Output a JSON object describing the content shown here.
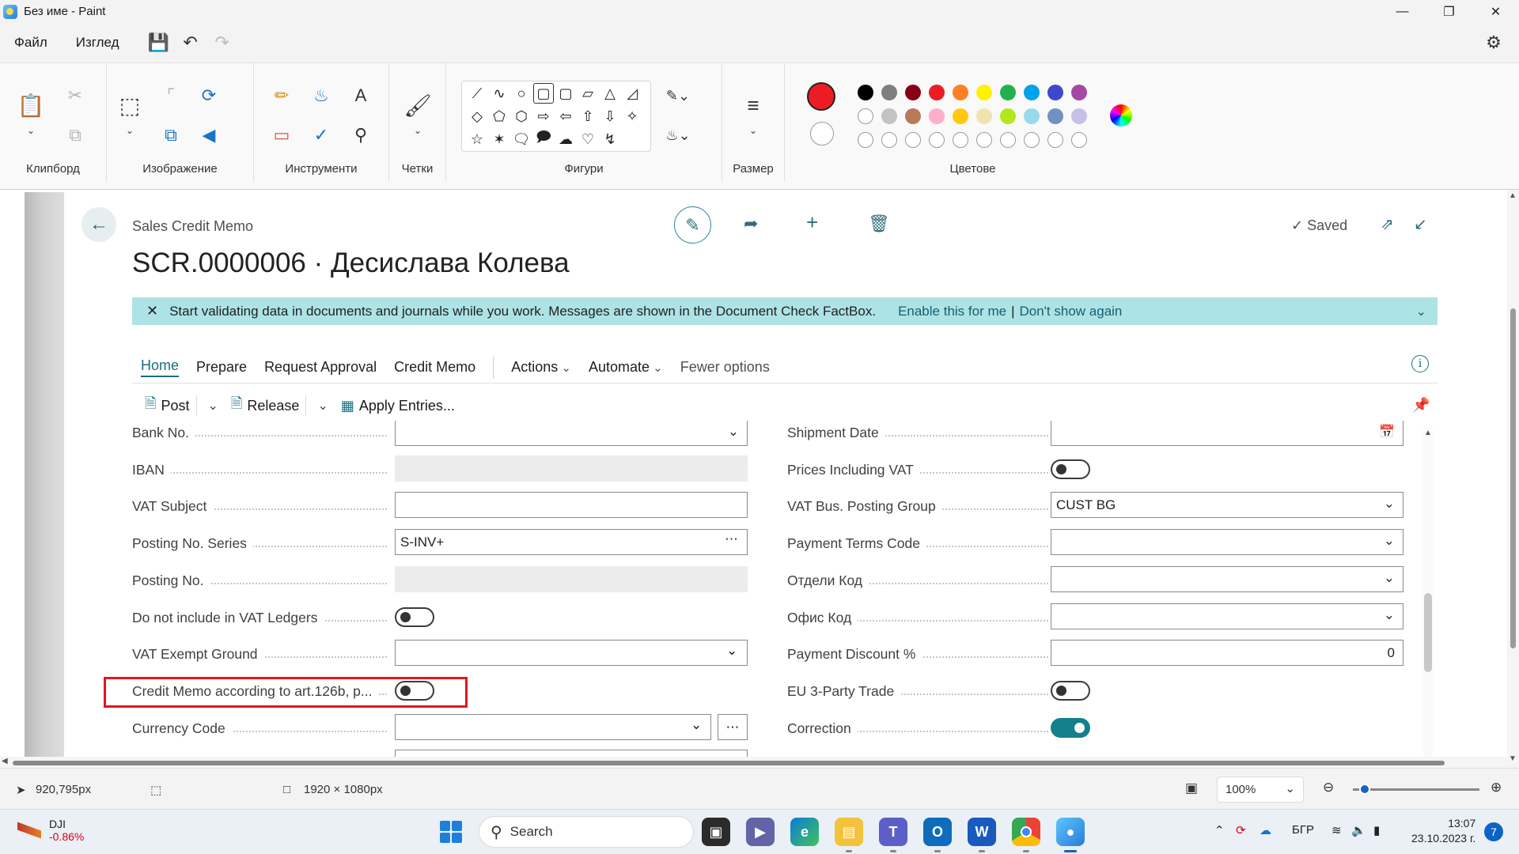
{
  "window": {
    "title": "Без име - Paint",
    "app_icon": "paint-icon",
    "controls": [
      "minimize-icon",
      "maximize-icon",
      "close-icon"
    ]
  },
  "menu": {
    "file": "Файл",
    "view": "Изглед",
    "icons": [
      "save-icon",
      "undo-icon",
      "redo-icon",
      "settings-icon"
    ]
  },
  "ribbon": {
    "groups": {
      "clipboard": "Клипборд",
      "image": "Изображение",
      "tools": "Инструменти",
      "brushes": "Четки",
      "shapes": "Фигури",
      "size": "Размер",
      "colors": "Цветове"
    },
    "palette_row1": [
      "#000000",
      "#7f7f7f",
      "#880015",
      "#ed1c24",
      "#ff7f27",
      "#fff200",
      "#22b14c",
      "#00a2e8",
      "#3f48cc",
      "#a349a4"
    ],
    "palette_row2": [
      "#ffffff",
      "#c3c3c3",
      "#b97a57",
      "#ffaec9",
      "#ffc90e",
      "#efe4b0",
      "#b5e61d",
      "#99d9ea",
      "#7092be",
      "#c8bfe7"
    ],
    "primary_color": "#ed1c24",
    "secondary_color": "#ffffff"
  },
  "bc": {
    "caption": "Sales Credit Memo",
    "title": "SCR.0000006 · Десислава Колева",
    "saved": "Saved",
    "banner": {
      "message": "Start validating data in documents and journals while you work. Messages are shown in the Document Check FactBox.",
      "enable": "Enable this for me",
      "separator": "|",
      "dismiss": "Don't show again"
    },
    "tabs": [
      "Home",
      "Prepare",
      "Request Approval",
      "Credit Memo",
      "Actions",
      "Automate",
      "Fewer options"
    ],
    "promoted": {
      "post": "Post",
      "release": "Release",
      "apply": "Apply Entries..."
    },
    "left_fields": [
      {
        "label": "Bank No.",
        "value": ""
      },
      {
        "label": "IBAN",
        "value": ""
      },
      {
        "label": "VAT Subject",
        "value": ""
      },
      {
        "label": "Posting No. Series",
        "value": "S-INV+"
      },
      {
        "label": "Posting No.",
        "value": ""
      },
      {
        "label": "Do not include in VAT Ledgers",
        "value": "off"
      },
      {
        "label": "VAT Exempt Ground",
        "value": ""
      },
      {
        "label": "Credit Memo according to art.126b, p...",
        "value": "off"
      },
      {
        "label": "Currency Code",
        "value": ""
      }
    ],
    "right_fields": [
      {
        "label": "Shipment Date",
        "value": ""
      },
      {
        "label": "Prices Including VAT",
        "value": "off"
      },
      {
        "label": "VAT Bus. Posting Group",
        "value": "CUST BG"
      },
      {
        "label": "Payment Terms Code",
        "value": ""
      },
      {
        "label": "Отдели Код",
        "value": ""
      },
      {
        "label": "Офис Код",
        "value": ""
      },
      {
        "label": "Payment Discount %",
        "value": "0"
      },
      {
        "label": "EU 3-Party Trade",
        "value": "off"
      },
      {
        "label": "Correction",
        "value": "on"
      }
    ],
    "accent_color": "#14808c",
    "highlight_color": "#e0171f"
  },
  "statusbar": {
    "cursor_pos": "920,795px",
    "image_size": "1920 × 1080px",
    "zoom": "100%"
  },
  "taskbar": {
    "stock_name": "DJI",
    "stock_change": "-0.86%",
    "search": "Search",
    "language": "БГР",
    "time": "13:07",
    "date": "23.10.2023 г.",
    "notifications": "7"
  }
}
